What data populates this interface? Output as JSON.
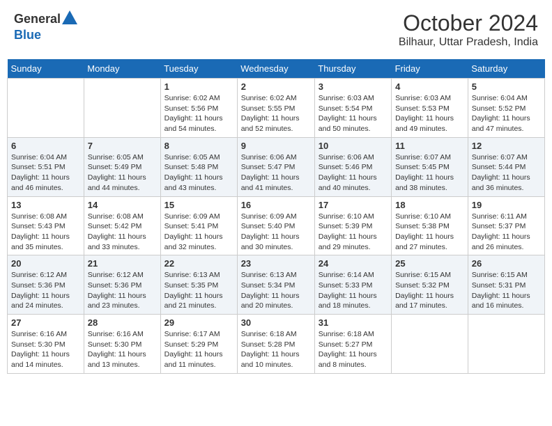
{
  "header": {
    "logo_general": "General",
    "logo_blue": "Blue",
    "month_title": "October 2024",
    "location": "Bilhaur, Uttar Pradesh, India"
  },
  "days_of_week": [
    "Sunday",
    "Monday",
    "Tuesday",
    "Wednesday",
    "Thursday",
    "Friday",
    "Saturday"
  ],
  "weeks": [
    [
      {
        "day": "",
        "info": ""
      },
      {
        "day": "",
        "info": ""
      },
      {
        "day": "1",
        "info": "Sunrise: 6:02 AM\nSunset: 5:56 PM\nDaylight: 11 hours and 54 minutes."
      },
      {
        "day": "2",
        "info": "Sunrise: 6:02 AM\nSunset: 5:55 PM\nDaylight: 11 hours and 52 minutes."
      },
      {
        "day": "3",
        "info": "Sunrise: 6:03 AM\nSunset: 5:54 PM\nDaylight: 11 hours and 50 minutes."
      },
      {
        "day": "4",
        "info": "Sunrise: 6:03 AM\nSunset: 5:53 PM\nDaylight: 11 hours and 49 minutes."
      },
      {
        "day": "5",
        "info": "Sunrise: 6:04 AM\nSunset: 5:52 PM\nDaylight: 11 hours and 47 minutes."
      }
    ],
    [
      {
        "day": "6",
        "info": "Sunrise: 6:04 AM\nSunset: 5:51 PM\nDaylight: 11 hours and 46 minutes."
      },
      {
        "day": "7",
        "info": "Sunrise: 6:05 AM\nSunset: 5:49 PM\nDaylight: 11 hours and 44 minutes."
      },
      {
        "day": "8",
        "info": "Sunrise: 6:05 AM\nSunset: 5:48 PM\nDaylight: 11 hours and 43 minutes."
      },
      {
        "day": "9",
        "info": "Sunrise: 6:06 AM\nSunset: 5:47 PM\nDaylight: 11 hours and 41 minutes."
      },
      {
        "day": "10",
        "info": "Sunrise: 6:06 AM\nSunset: 5:46 PM\nDaylight: 11 hours and 40 minutes."
      },
      {
        "day": "11",
        "info": "Sunrise: 6:07 AM\nSunset: 5:45 PM\nDaylight: 11 hours and 38 minutes."
      },
      {
        "day": "12",
        "info": "Sunrise: 6:07 AM\nSunset: 5:44 PM\nDaylight: 11 hours and 36 minutes."
      }
    ],
    [
      {
        "day": "13",
        "info": "Sunrise: 6:08 AM\nSunset: 5:43 PM\nDaylight: 11 hours and 35 minutes."
      },
      {
        "day": "14",
        "info": "Sunrise: 6:08 AM\nSunset: 5:42 PM\nDaylight: 11 hours and 33 minutes."
      },
      {
        "day": "15",
        "info": "Sunrise: 6:09 AM\nSunset: 5:41 PM\nDaylight: 11 hours and 32 minutes."
      },
      {
        "day": "16",
        "info": "Sunrise: 6:09 AM\nSunset: 5:40 PM\nDaylight: 11 hours and 30 minutes."
      },
      {
        "day": "17",
        "info": "Sunrise: 6:10 AM\nSunset: 5:39 PM\nDaylight: 11 hours and 29 minutes."
      },
      {
        "day": "18",
        "info": "Sunrise: 6:10 AM\nSunset: 5:38 PM\nDaylight: 11 hours and 27 minutes."
      },
      {
        "day": "19",
        "info": "Sunrise: 6:11 AM\nSunset: 5:37 PM\nDaylight: 11 hours and 26 minutes."
      }
    ],
    [
      {
        "day": "20",
        "info": "Sunrise: 6:12 AM\nSunset: 5:36 PM\nDaylight: 11 hours and 24 minutes."
      },
      {
        "day": "21",
        "info": "Sunrise: 6:12 AM\nSunset: 5:36 PM\nDaylight: 11 hours and 23 minutes."
      },
      {
        "day": "22",
        "info": "Sunrise: 6:13 AM\nSunset: 5:35 PM\nDaylight: 11 hours and 21 minutes."
      },
      {
        "day": "23",
        "info": "Sunrise: 6:13 AM\nSunset: 5:34 PM\nDaylight: 11 hours and 20 minutes."
      },
      {
        "day": "24",
        "info": "Sunrise: 6:14 AM\nSunset: 5:33 PM\nDaylight: 11 hours and 18 minutes."
      },
      {
        "day": "25",
        "info": "Sunrise: 6:15 AM\nSunset: 5:32 PM\nDaylight: 11 hours and 17 minutes."
      },
      {
        "day": "26",
        "info": "Sunrise: 6:15 AM\nSunset: 5:31 PM\nDaylight: 11 hours and 16 minutes."
      }
    ],
    [
      {
        "day": "27",
        "info": "Sunrise: 6:16 AM\nSunset: 5:30 PM\nDaylight: 11 hours and 14 minutes."
      },
      {
        "day": "28",
        "info": "Sunrise: 6:16 AM\nSunset: 5:30 PM\nDaylight: 11 hours and 13 minutes."
      },
      {
        "day": "29",
        "info": "Sunrise: 6:17 AM\nSunset: 5:29 PM\nDaylight: 11 hours and 11 minutes."
      },
      {
        "day": "30",
        "info": "Sunrise: 6:18 AM\nSunset: 5:28 PM\nDaylight: 11 hours and 10 minutes."
      },
      {
        "day": "31",
        "info": "Sunrise: 6:18 AM\nSunset: 5:27 PM\nDaylight: 11 hours and 8 minutes."
      },
      {
        "day": "",
        "info": ""
      },
      {
        "day": "",
        "info": ""
      }
    ]
  ]
}
